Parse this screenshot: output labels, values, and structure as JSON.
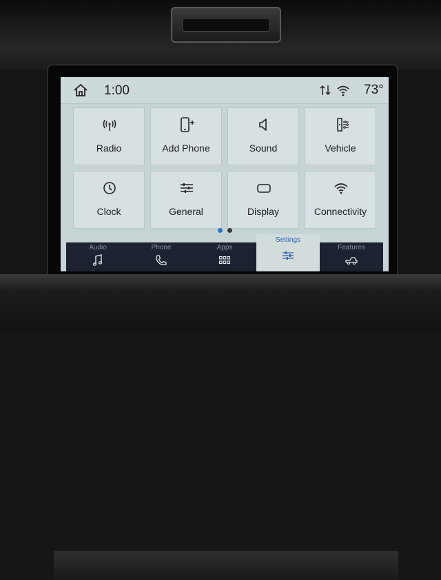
{
  "status_bar": {
    "time": "1:00",
    "temperature": "73°"
  },
  "tiles": [
    {
      "label": "Radio",
      "icon": "radio-antenna-icon"
    },
    {
      "label": "Add Phone",
      "icon": "add-phone-icon"
    },
    {
      "label": "Sound",
      "icon": "speaker-icon"
    },
    {
      "label": "Vehicle",
      "icon": "vehicle-settings-icon"
    },
    {
      "label": "Clock",
      "icon": "clock-icon"
    },
    {
      "label": "General",
      "icon": "sliders-icon"
    },
    {
      "label": "Display",
      "icon": "display-icon"
    },
    {
      "label": "Connectivity",
      "icon": "wifi-icon"
    }
  ],
  "pagination": {
    "current_page": 1,
    "total_pages": 2,
    "active_color": "#2f78c8",
    "inactive_color": "#3a3a3a"
  },
  "nav": [
    {
      "label": "Audio",
      "icon": "music-note-icon"
    },
    {
      "label": "Phone",
      "icon": "phone-icon"
    },
    {
      "label": "Apps",
      "icon": "apps-grid-icon"
    },
    {
      "label": "Settings",
      "icon": "settings-sliders-icon",
      "active": true
    },
    {
      "label": "Features",
      "icon": "truck-icon"
    }
  ],
  "colors": {
    "accent": "#2f5fa8",
    "screen_bg": "#c6d4d6",
    "nav_bg": "#1c2230"
  }
}
